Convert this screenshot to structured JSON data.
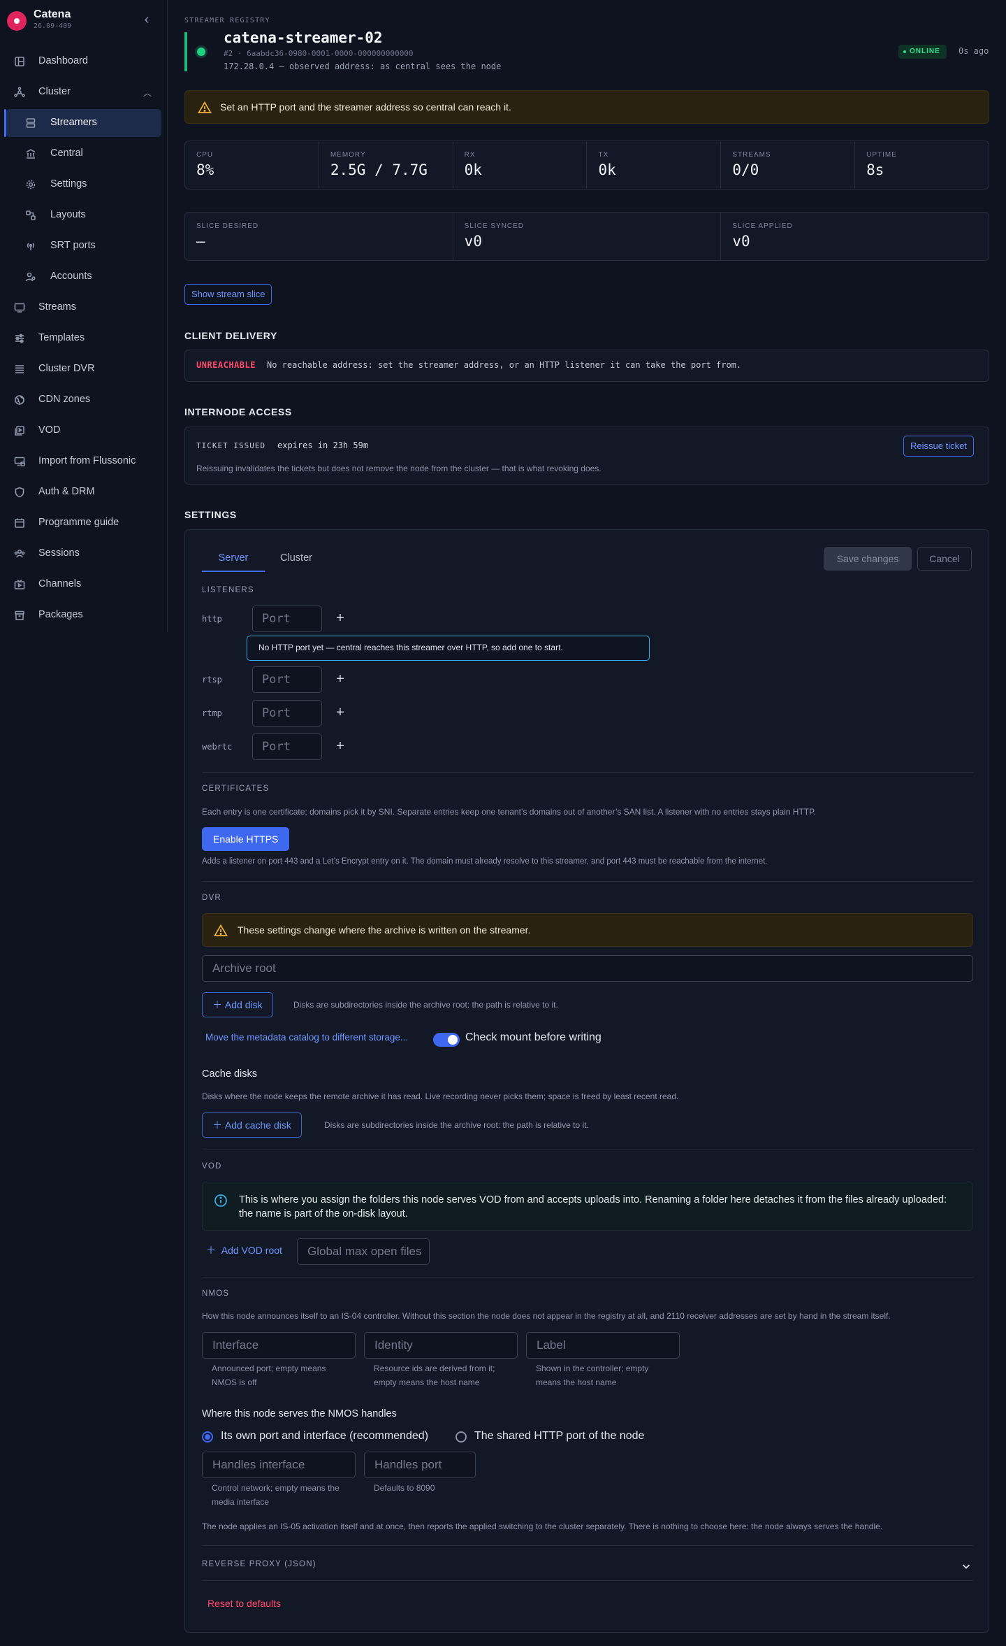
{
  "app": {
    "name": "Catena",
    "version": "26.09-409"
  },
  "sidebar": {
    "items": [
      {
        "label": "Dashboard",
        "icon": "dashboard-icon"
      },
      {
        "label": "Cluster",
        "icon": "cluster-icon",
        "expanded": true
      },
      {
        "label": "Streamers",
        "icon": "streamers-icon",
        "active": true
      },
      {
        "label": "Central",
        "icon": "central-icon"
      },
      {
        "label": "Settings",
        "icon": "gear-icon"
      },
      {
        "label": "Layouts",
        "icon": "layouts-icon"
      },
      {
        "label": "SRT ports",
        "icon": "antenna-icon"
      },
      {
        "label": "Accounts",
        "icon": "accounts-icon"
      },
      {
        "label": "Streams",
        "icon": "monitor-icon"
      },
      {
        "label": "Templates",
        "icon": "sliders-icon"
      },
      {
        "label": "Cluster DVR",
        "icon": "list-icon"
      },
      {
        "label": "CDN zones",
        "icon": "globe-icon"
      },
      {
        "label": "VOD",
        "icon": "vod-icon"
      },
      {
        "label": "Import from Flussonic",
        "icon": "import-icon"
      },
      {
        "label": "Auth & DRM",
        "icon": "shield-icon"
      },
      {
        "label": "Programme guide",
        "icon": "calendar-icon"
      },
      {
        "label": "Sessions",
        "icon": "users-icon"
      },
      {
        "label": "Channels",
        "icon": "channels-icon"
      },
      {
        "label": "Packages",
        "icon": "package-icon"
      }
    ]
  },
  "header": {
    "eyebrow": "STREAMER REGISTRY",
    "name": "catena-streamer-02",
    "id_line": "#2 · 6aabdc36-0980-0001-0000-000000000000",
    "address_line": "172.28.0.4 — observed address: as central sees the node",
    "status": "ONLINE",
    "last_seen": "0s ago",
    "status_color": "#2fe08f"
  },
  "warning": "Set an HTTP port and the streamer address so central can reach it.",
  "stats": [
    {
      "label": "CPU",
      "value": "8%"
    },
    {
      "label": "MEMORY",
      "value": "2.5G / 7.7G"
    },
    {
      "label": "RX",
      "value": "0k"
    },
    {
      "label": "TX",
      "value": "0k"
    },
    {
      "label": "STREAMS",
      "value": "0/0"
    },
    {
      "label": "UPTIME",
      "value": "8s"
    }
  ],
  "slice": [
    {
      "label": "SLICE DESIRED",
      "value": "—"
    },
    {
      "label": "SLICE SYNCED",
      "value": "v0"
    },
    {
      "label": "SLICE APPLIED",
      "value": "v0"
    }
  ],
  "show_slice_label": "Show stream slice",
  "client_delivery": {
    "title": "CLIENT DELIVERY",
    "tag": "UNREACHABLE",
    "text": "No reachable address: set the streamer address, or an HTTP listener it can take the port from."
  },
  "internode": {
    "title": "INTERNODE ACCESS",
    "tag": "TICKET ISSUED",
    "expires": "expires in 23h 59m",
    "reissue_label": "Reissue ticket",
    "note": "Reissuing invalidates the tickets but does not remove the node from the cluster — that is what revoking does."
  },
  "settings": {
    "title": "SETTINGS",
    "tabs": [
      "Server",
      "Cluster"
    ],
    "save_label": "Save changes",
    "cancel_label": "Cancel",
    "listeners": {
      "title": "LISTENERS",
      "rows": [
        {
          "proto": "http",
          "placeholder": "Port"
        },
        {
          "proto": "rtsp",
          "placeholder": "Port"
        },
        {
          "proto": "rtmp",
          "placeholder": "Port"
        },
        {
          "proto": "webrtc",
          "placeholder": "Port"
        }
      ],
      "add_symbol": "+",
      "http_hint": "No HTTP port yet — central reaches this streamer over HTTP, so add one to start."
    },
    "certificates": {
      "title": "CERTIFICATES",
      "desc": "Each entry is one certificate; domains pick it by SNI. Separate entries keep one tenant’s domains out of another’s SAN list. A listener with no entries stays plain HTTP.",
      "enable_label": "Enable HTTPS",
      "note": "Adds a listener on port 443 and a Let’s Encrypt entry on it. The domain must already resolve to this streamer, and port 443 must be reachable from the internet."
    },
    "dvr": {
      "title": "DVR",
      "warning": "These settings change where the archive is written on the streamer.",
      "archive_root_placeholder": "Archive root",
      "add_disk_label": "Add disk",
      "disk_note": "Disks are subdirectories inside the archive root: the path is relative to it.",
      "move_catalog_label": "Move the metadata catalog to different storage...",
      "check_mount_label": "Check mount before writing",
      "check_mount_on": true,
      "cache_title": "Cache disks",
      "cache_desc": "Disks where the node keeps the remote archive it has read. Live recording never picks them; space is freed by least recent read.",
      "add_cache_label": "Add cache disk",
      "cache_note": "Disks are subdirectories inside the archive root: the path is relative to it."
    },
    "vod": {
      "title": "VOD",
      "info": "This is where you assign the folders this node serves VOD from and accepts uploads into. Renaming a folder here detaches it from the files already uploaded: the name is part of the on-disk layout.",
      "add_root_label": "Add VOD root",
      "max_open_placeholder": "Global max open files"
    },
    "nmos": {
      "title": "NMOS",
      "desc": "How this node announces itself to an IS-04 controller. Without this section the node does not appear in the registry at all, and 2110 receiver addresses are set by hand in the stream itself.",
      "fields": [
        {
          "placeholder": "Interface",
          "help": "Announced port; empty means NMOS is off"
        },
        {
          "placeholder": "Identity",
          "help": "Resource ids are derived from it; empty means the host name"
        },
        {
          "placeholder": "Label",
          "help": "Shown in the controller; empty means the host name"
        }
      ],
      "handles_title": "Where this node serves the NMOS handles",
      "handles_options": [
        "Its own port and interface (recommended)",
        "The shared HTTP port of the node"
      ],
      "handles_selected": 0,
      "handles_fields": [
        {
          "placeholder": "Handles interface",
          "help": "Control network; empty means the media interface"
        },
        {
          "placeholder": "Handles port",
          "help": "Defaults to 8090"
        }
      ],
      "activation_note": "The node applies an IS-05 activation itself and at once, then reports the applied switching to the cluster separately. There is nothing to choose here: the node always serves the handle."
    },
    "reverse_proxy_title": "REVERSE PROXY (JSON)",
    "reset_label": "Reset to defaults"
  },
  "colors": {
    "accent": "#3d68ef",
    "online": "#2fe08f",
    "danger": "#ff4b6a",
    "warning": "#f3b33d",
    "info": "#38b2e8"
  }
}
